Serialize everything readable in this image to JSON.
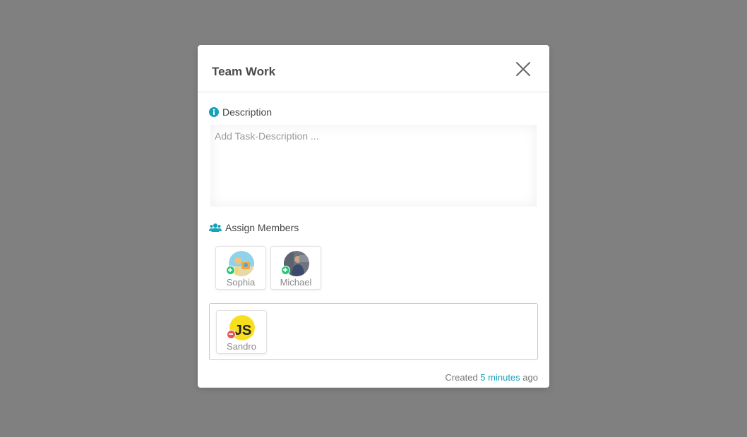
{
  "modal": {
    "title": "Team Work"
  },
  "description": {
    "label": "Description",
    "placeholder": "Add Task-Description ..."
  },
  "members": {
    "label": "Assign Members",
    "available": [
      {
        "name": "Sophia",
        "action": "add"
      },
      {
        "name": "Michael",
        "action": "add"
      }
    ],
    "assigned": [
      {
        "name": "Sandro",
        "action": "remove"
      }
    ]
  },
  "footer": {
    "prefix": "Created",
    "time": "5 minutes",
    "suffix": "ago"
  },
  "colors": {
    "accent": "#17a2b8",
    "add_badge": "#28c76f",
    "remove_badge": "#ea5455",
    "overlay": "#808080"
  }
}
